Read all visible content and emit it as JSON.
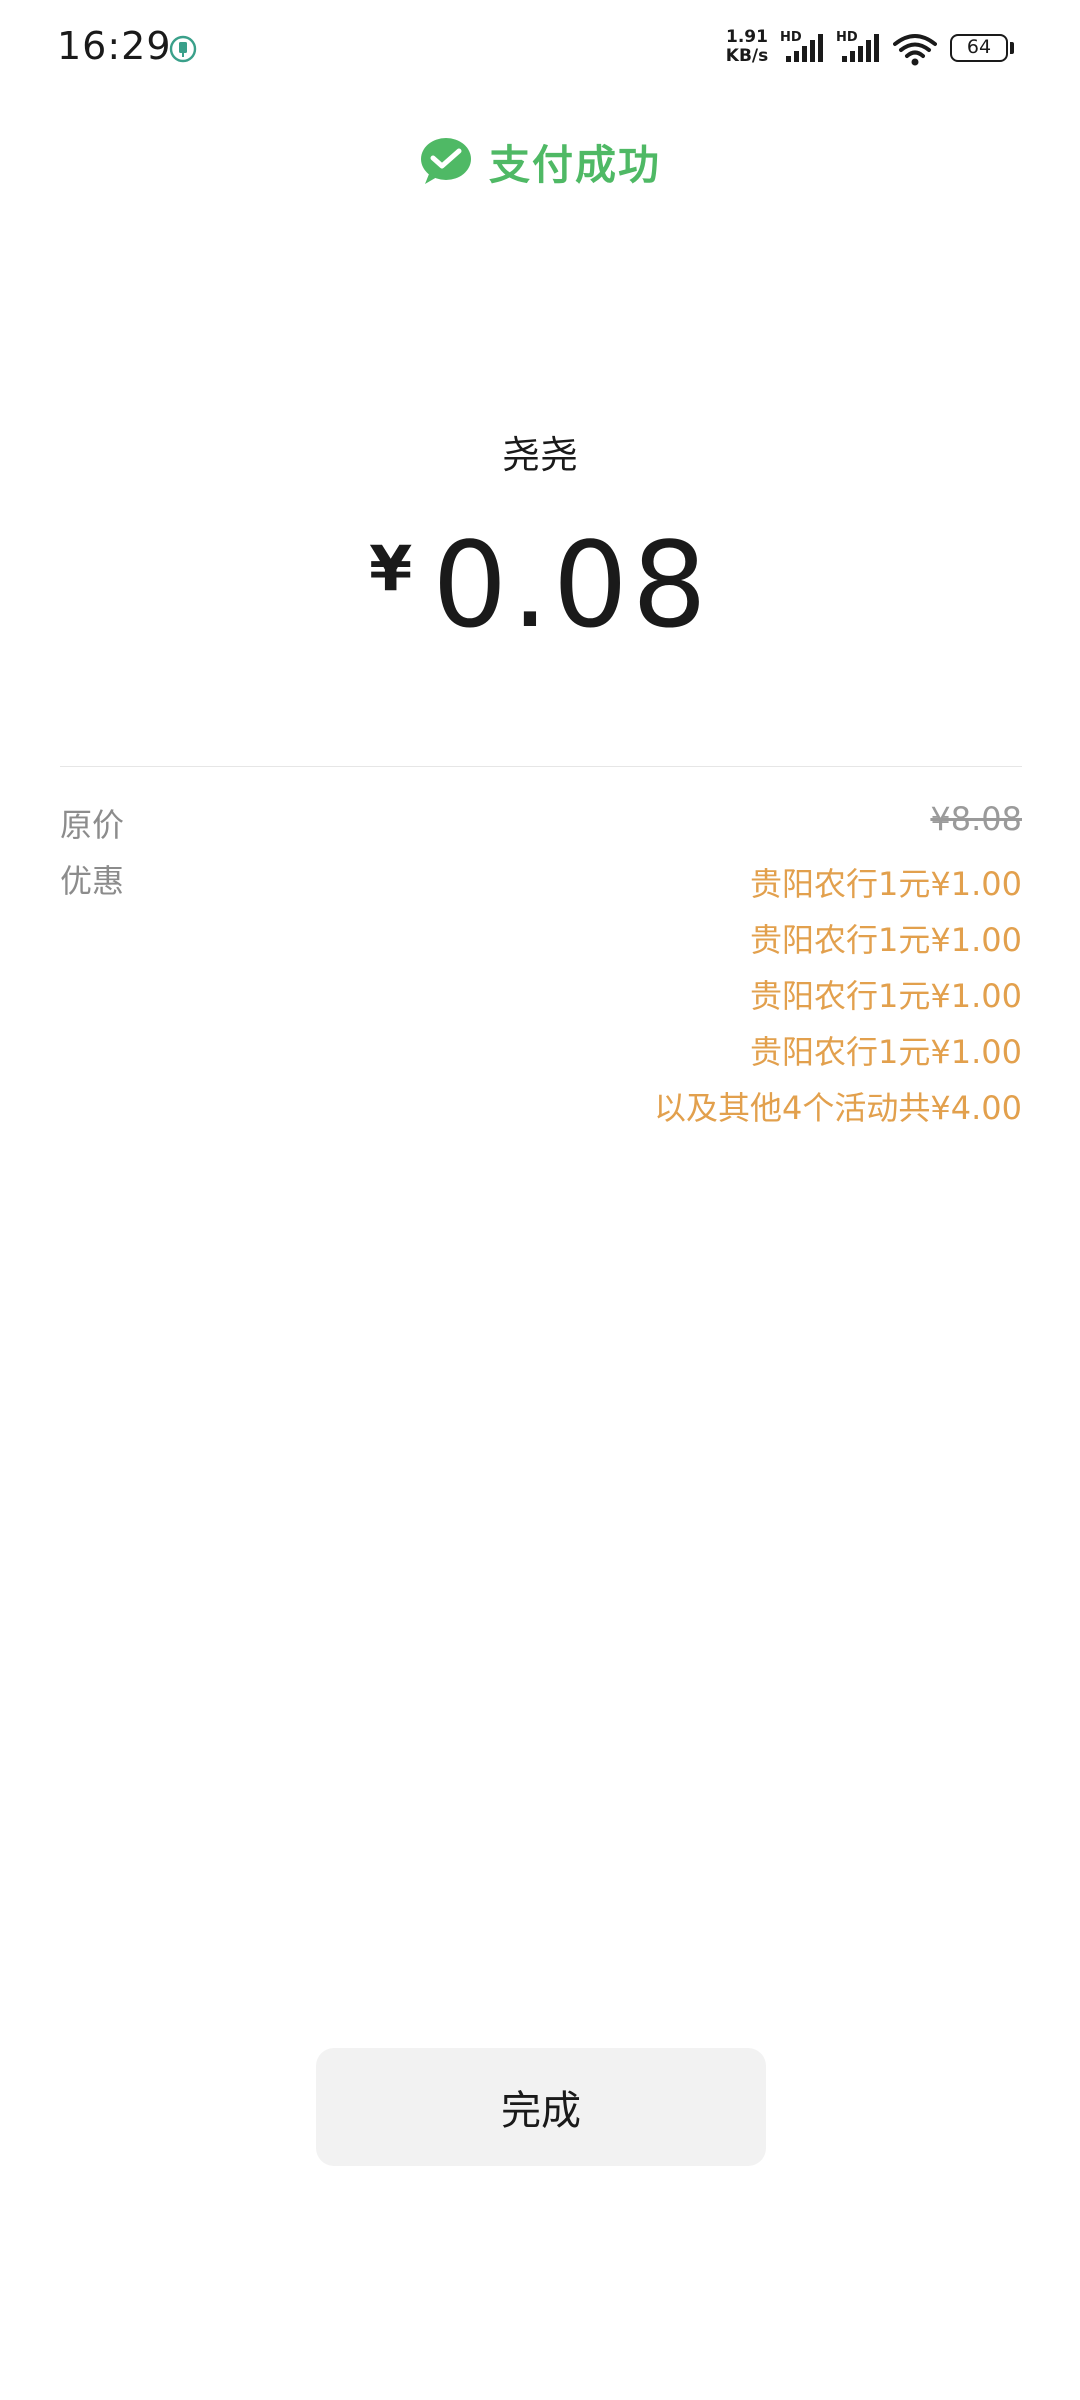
{
  "status_bar": {
    "time": "16:29",
    "net_speed_value": "1.91",
    "net_speed_unit": "KB/s",
    "signal_1_badge": "HD",
    "signal_2_badge": "HD",
    "battery_level": "64",
    "icons": [
      "app-notification-icon",
      "signal-icon",
      "signal-icon",
      "wifi-icon",
      "battery-icon"
    ]
  },
  "header": {
    "icon": "wechat-pay-icon",
    "title": "支付成功",
    "accent_color": "#4fb965"
  },
  "payment": {
    "merchant": "尧尧",
    "currency_symbol": "¥",
    "amount": "0.08"
  },
  "details": {
    "original_label": "原价",
    "original_price": "¥8.08",
    "discount_label": "优惠",
    "discount_color": "#e2a04d",
    "discounts": [
      "贵阳农行1元¥1.00",
      "贵阳农行1元¥1.00",
      "贵阳农行1元¥1.00",
      "贵阳农行1元¥1.00",
      "以及其他4个活动共¥4.00"
    ]
  },
  "actions": {
    "done_label": "完成"
  }
}
